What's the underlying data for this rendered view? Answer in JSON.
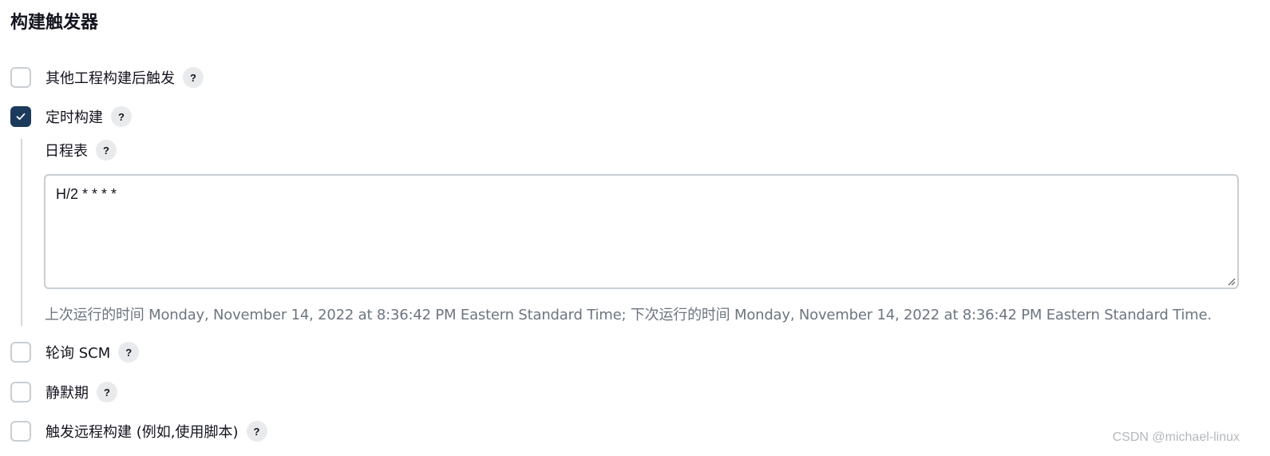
{
  "section": {
    "title": "构建触发器"
  },
  "triggers": [
    {
      "label": "其他工程构建后触发",
      "checked": false,
      "help": "?"
    },
    {
      "label": "定时构建",
      "checked": true,
      "help": "?"
    },
    {
      "label": "轮询 SCM",
      "checked": false,
      "help": "?"
    },
    {
      "label": "静默期",
      "checked": false,
      "help": "?"
    },
    {
      "label": "触发远程构建 (例如,使用脚本)",
      "checked": false,
      "help": "?"
    }
  ],
  "schedule": {
    "label": "日程表",
    "help": "?",
    "value": "H/2 * * * *",
    "info": "上次运行的时间 Monday, November 14, 2022 at 8:36:42 PM Eastern Standard Time; 下次运行的时间 Monday, November 14, 2022 at 8:36:42 PM Eastern Standard Time."
  },
  "watermark": "CSDN @michael-linux",
  "colors": {
    "checked": "#1b3a5c",
    "border": "#c9ced3",
    "help_bg": "#e9eaec",
    "info_text": "#6d7580"
  }
}
